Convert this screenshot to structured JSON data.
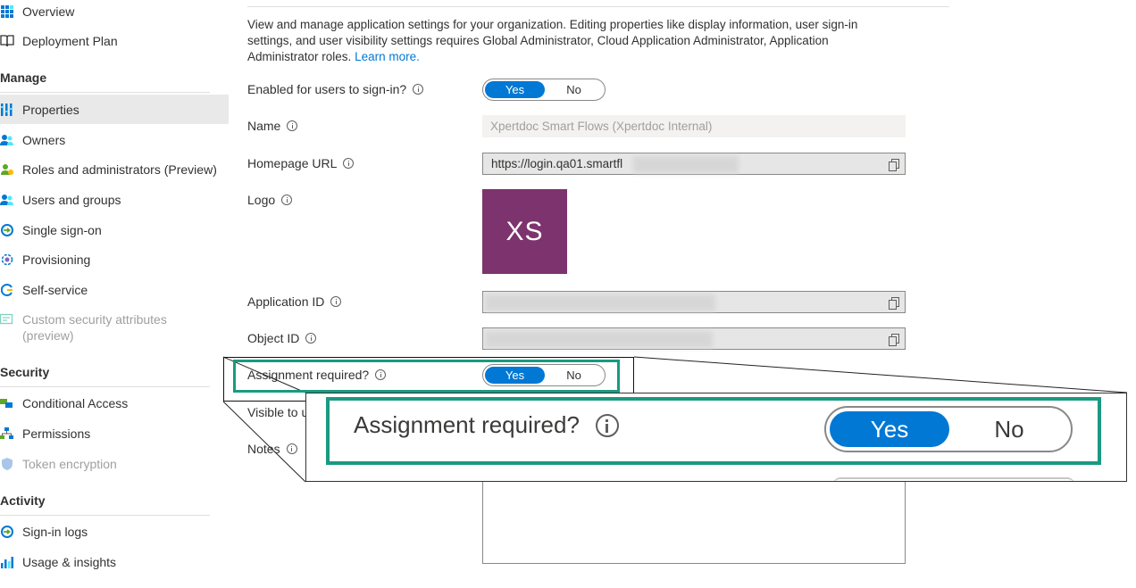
{
  "sidebar": {
    "items": [
      {
        "label": "Overview",
        "icon": "grid-icon"
      },
      {
        "label": "Deployment Plan",
        "icon": "book-icon"
      },
      {
        "label": "Properties",
        "icon": "properties-icon",
        "selected": true
      },
      {
        "label": "Owners",
        "icon": "owners-icon"
      },
      {
        "label": "Roles and administrators (Preview)",
        "icon": "roles-icon"
      },
      {
        "label": "Users and groups",
        "icon": "users-icon"
      },
      {
        "label": "Single sign-on",
        "icon": "sso-icon"
      },
      {
        "label": "Provisioning",
        "icon": "provisioning-icon"
      },
      {
        "label": "Self-service",
        "icon": "self-service-icon"
      },
      {
        "label": "Custom security attributes (preview)",
        "icon": "security-attributes-icon",
        "disabled": true
      },
      {
        "label": "Conditional Access",
        "icon": "conditional-access-icon"
      },
      {
        "label": "Permissions",
        "icon": "permissions-icon"
      },
      {
        "label": "Token encryption",
        "icon": "shield-icon",
        "disabled": true
      },
      {
        "label": "Sign-in logs",
        "icon": "sign-in-logs-icon"
      },
      {
        "label": "Usage & insights",
        "icon": "usage-icon"
      }
    ],
    "sections": {
      "manage": "Manage",
      "security": "Security",
      "activity": "Activity"
    }
  },
  "main": {
    "intro_text": "View and manage application settings for your organization. Editing properties like display information, user sign-in settings, and user visibility settings requires Global Administrator, Cloud Application Administrator, Application Administrator roles.",
    "learn_more": "Learn more.",
    "fields": {
      "enabled_label": "Enabled for users to sign-in?",
      "name_label": "Name",
      "name_value": "Xpertdoc Smart Flows (Xpertdoc Internal)",
      "homepage_label": "Homepage URL",
      "homepage_value": "https://login.qa01.smartfl",
      "logo_label": "Logo",
      "logo_text": "XS",
      "app_id_label": "Application ID",
      "object_id_label": "Object ID",
      "assignment_label": "Assignment required?",
      "visible_label": "Visible to u",
      "notes_label": "Notes"
    },
    "toggle": {
      "yes": "Yes",
      "no": "No"
    }
  },
  "callout": {
    "label": "Assignment required?",
    "yes": "Yes",
    "no": "No"
  },
  "colors": {
    "accent": "#0078d4",
    "highlight": "#1a9a80",
    "logo_bg": "#7d336e",
    "selected_bg": "#e9e9e9"
  }
}
